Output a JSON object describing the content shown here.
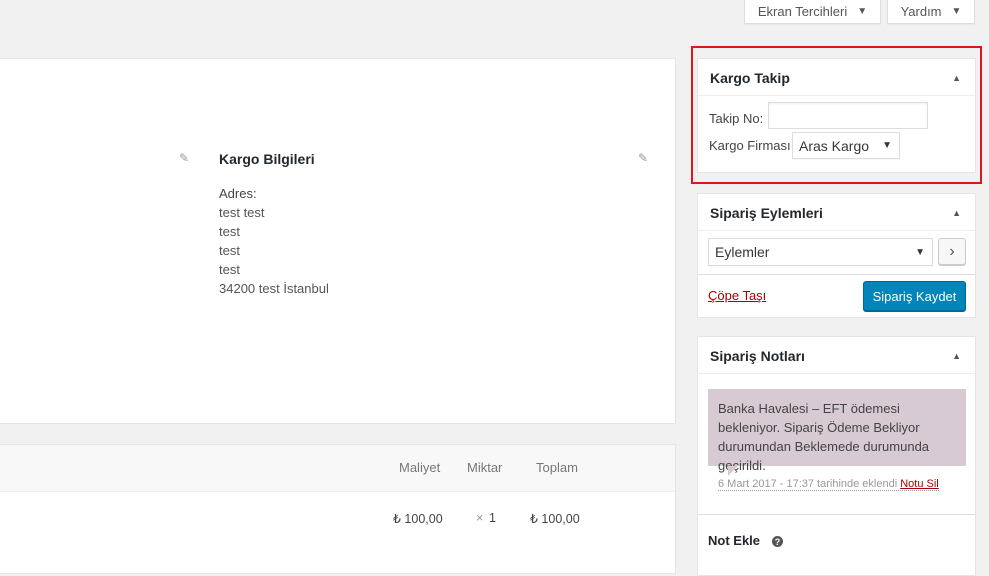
{
  "top_buttons": {
    "screen_options": "Ekran Tercihleri",
    "help": "Yardım",
    "caret": "▼"
  },
  "shipping": {
    "title": "Kargo Bilgileri",
    "address_label": "Adres:",
    "address_lines": [
      "test test",
      "test",
      "test",
      "test",
      "34200 test İstanbul"
    ]
  },
  "items_table": {
    "headers": {
      "cost": "Maliyet",
      "qty": "Miktar",
      "total": "Toplam"
    },
    "rows": [
      {
        "cost": "₺ 100,00",
        "qty_symbol": "×",
        "qty": "1",
        "total": "₺ 100,00"
      }
    ]
  },
  "kargo_takip": {
    "title": "Kargo Takip",
    "tracking_label": "Takip No:",
    "tracking_value": "",
    "carrier_label": "Kargo Firması",
    "carrier_selected": "Aras Kargo"
  },
  "order_actions": {
    "title": "Sipariş Eylemleri",
    "select_value": "Eylemler",
    "go_icon": "›",
    "trash_label": "Çöpe Taşı",
    "save_label": "Sipariş Kaydet"
  },
  "order_notes": {
    "title": "Sipariş Notları",
    "note_text": "Banka Havalesi – EFT ödemesi bekleniyor. Sipariş Ödeme Bekliyor durumundan Beklemede durumunda geçirildi.",
    "note_meta": "6 Mart 2017 - 17:37 tarihinde eklendi",
    "delete_label": "Notu Sil",
    "add_note_label": "Not Ekle",
    "help_glyph": "?"
  },
  "colors": {
    "primary": "#0085ba",
    "note_bg": "#d7cad2",
    "highlight": "#e0161b",
    "danger": "#a00"
  }
}
